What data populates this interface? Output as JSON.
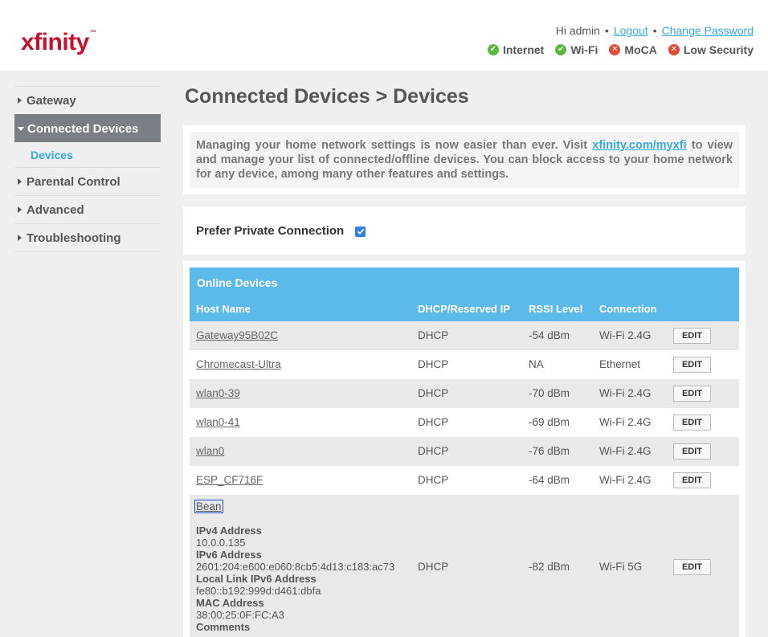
{
  "brand": {
    "logo": "xfinity",
    "accent": "#c8102e"
  },
  "header": {
    "greeting": "Hi admin",
    "logout": "Logout",
    "change_password": "Change Password",
    "status": [
      {
        "label": "Internet",
        "state": "ok",
        "icon": "check-circle-icon"
      },
      {
        "label": "Wi-Fi",
        "state": "ok",
        "icon": "check-circle-icon"
      },
      {
        "label": "MoCA",
        "state": "bad",
        "icon": "x-circle-icon"
      },
      {
        "label": "Low Security",
        "state": "bad",
        "icon": "x-circle-icon"
      }
    ]
  },
  "sidebar": {
    "items": [
      {
        "label": "Gateway"
      },
      {
        "label": "Connected Devices",
        "active": true
      },
      {
        "label": "Devices",
        "sub": true
      },
      {
        "label": "Parental Control"
      },
      {
        "label": "Advanced"
      },
      {
        "label": "Troubleshooting"
      }
    ]
  },
  "page": {
    "title": "Connected Devices > Devices",
    "info_before": "Managing your home network settings is now easier than ever. Visit ",
    "info_link": "xfinity.com/myxfi",
    "info_after": " to view and manage your list of connected/offline devices. You can block access to your home network for any device, among many other features and settings.",
    "prefer_private_label": "Prefer Private Connection",
    "prefer_private_checked": true
  },
  "table": {
    "title": "Online Devices",
    "columns": [
      "Host Name",
      "DHCP/Reserved IP",
      "RSSI Level",
      "Connection"
    ],
    "edit_label": "EDIT",
    "rows": [
      {
        "host": "Gateway95B02C",
        "dhcp": "DHCP",
        "rssi": "-54 dBm",
        "conn": "Wi-Fi 2.4G"
      },
      {
        "host": "Chromecast-Ultra",
        "dhcp": "DHCP",
        "rssi": "NA",
        "conn": "Ethernet"
      },
      {
        "host": "wlan0-39",
        "dhcp": "DHCP",
        "rssi": "-70 dBm",
        "conn": "Wi-Fi 2.4G"
      },
      {
        "host": "wlan0-41",
        "dhcp": "DHCP",
        "rssi": "-69 dBm",
        "conn": "Wi-Fi 2.4G"
      },
      {
        "host": "wlan0",
        "dhcp": "DHCP",
        "rssi": "-76 dBm",
        "conn": "Wi-Fi 2.4G"
      },
      {
        "host": "ESP_CF716F",
        "dhcp": "DHCP",
        "rssi": "-64 dBm",
        "conn": "Wi-Fi 2.4G"
      }
    ],
    "expanded": {
      "host": "Bean",
      "dhcp": "DHCP",
      "rssi": "-82 dBm",
      "conn": "Wi-Fi 5G",
      "ipv4_label": "IPv4 Address",
      "ipv4": "10.0.0.135",
      "ipv6_label": "IPv6 Address",
      "ipv6": "2601:204:e600:e060:8cb5:4d13:c183:ac73",
      "llipv6_label": "Local Link IPv6 Address",
      "llipv6": "fe80::b192:999d:d461:dbfa",
      "mac_label": "MAC Address",
      "mac": "38:00:25:0F:FC:A3",
      "comments_label": "Comments"
    }
  }
}
